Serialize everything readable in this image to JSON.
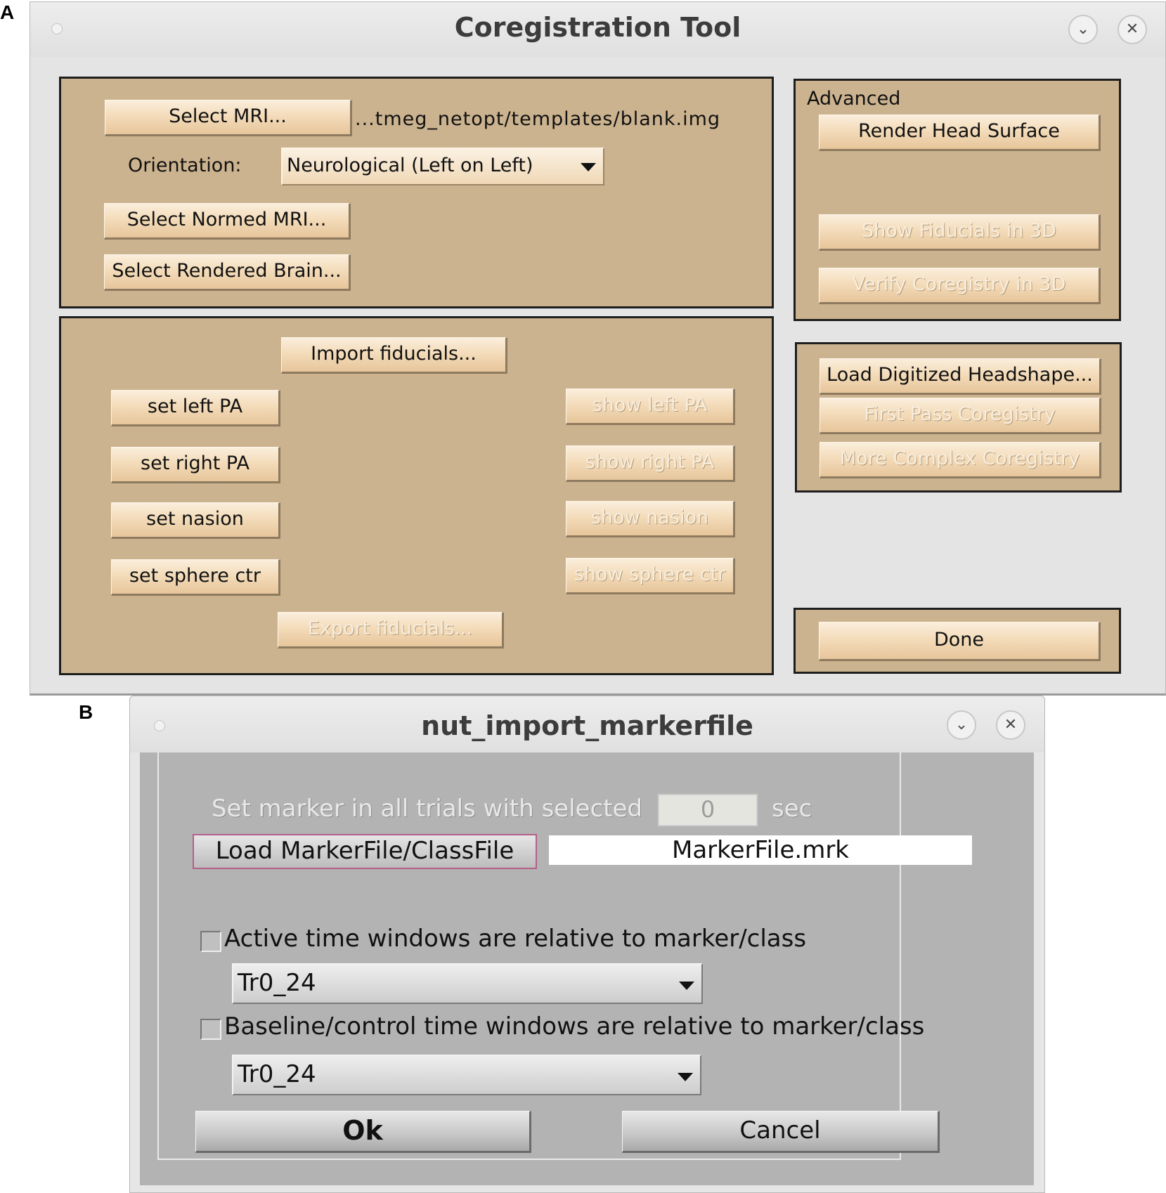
{
  "panels": {
    "a": "A",
    "b": "B"
  },
  "coreg": {
    "title": "Coregistration Tool",
    "colors": {
      "panel_bg": "#ccb38f",
      "button_top": "#faeedc",
      "border": "#1e1e1e"
    },
    "select_mri_label": "Select MRI...",
    "mri_path": "...tmeg_netopt/templates/blank.img",
    "orientation_label": "Orientation:",
    "orientation_value": "Neurological (Left on Left)",
    "select_normed_mri_label": "Select Normed MRI...",
    "select_rendered_brain_label": "Select Rendered Brain...",
    "import_fiducials_label": "Import fiducials...",
    "set_left_pa_label": "set left PA",
    "set_right_pa_label": "set right PA",
    "set_nasion_label": "set nasion",
    "set_sphere_ctr_label": "set sphere ctr",
    "show_left_pa_label": "show left PA",
    "show_right_pa_label": "show right PA",
    "show_nasion_label": "show nasion",
    "show_sphere_ctr_label": "show sphere ctr",
    "export_fiducials_label": "Export fiducials...",
    "advanced_label": "Advanced",
    "render_head_surface_label": "Render Head Surface",
    "show_fiducials_3d_label": "Show Fiducials in 3D",
    "verify_coregistry_3d_label": "Verify Coregistry in 3D",
    "load_headshape_label": "Load Digitized Headshape...",
    "first_pass_label": "First Pass Coregistry",
    "more_complex_label": "More Complex Coregistry",
    "done_label": "Done"
  },
  "marker": {
    "title": "nut_import_markerfile",
    "set_marker_label": "Set marker in all trials with selected",
    "set_marker_value": "0",
    "sec_label": "sec",
    "load_button_label": "Load MarkerFile/ClassFile",
    "filename": "MarkerFile.mrk",
    "active_checkbox_label": "Active time windows are relative to marker/class",
    "active_select_value": "Tr0_24",
    "baseline_checkbox_label": "Baseline/control time windows are relative to marker/class",
    "baseline_select_value": "Tr0_24",
    "ok_label": "Ok",
    "cancel_label": "Cancel"
  }
}
